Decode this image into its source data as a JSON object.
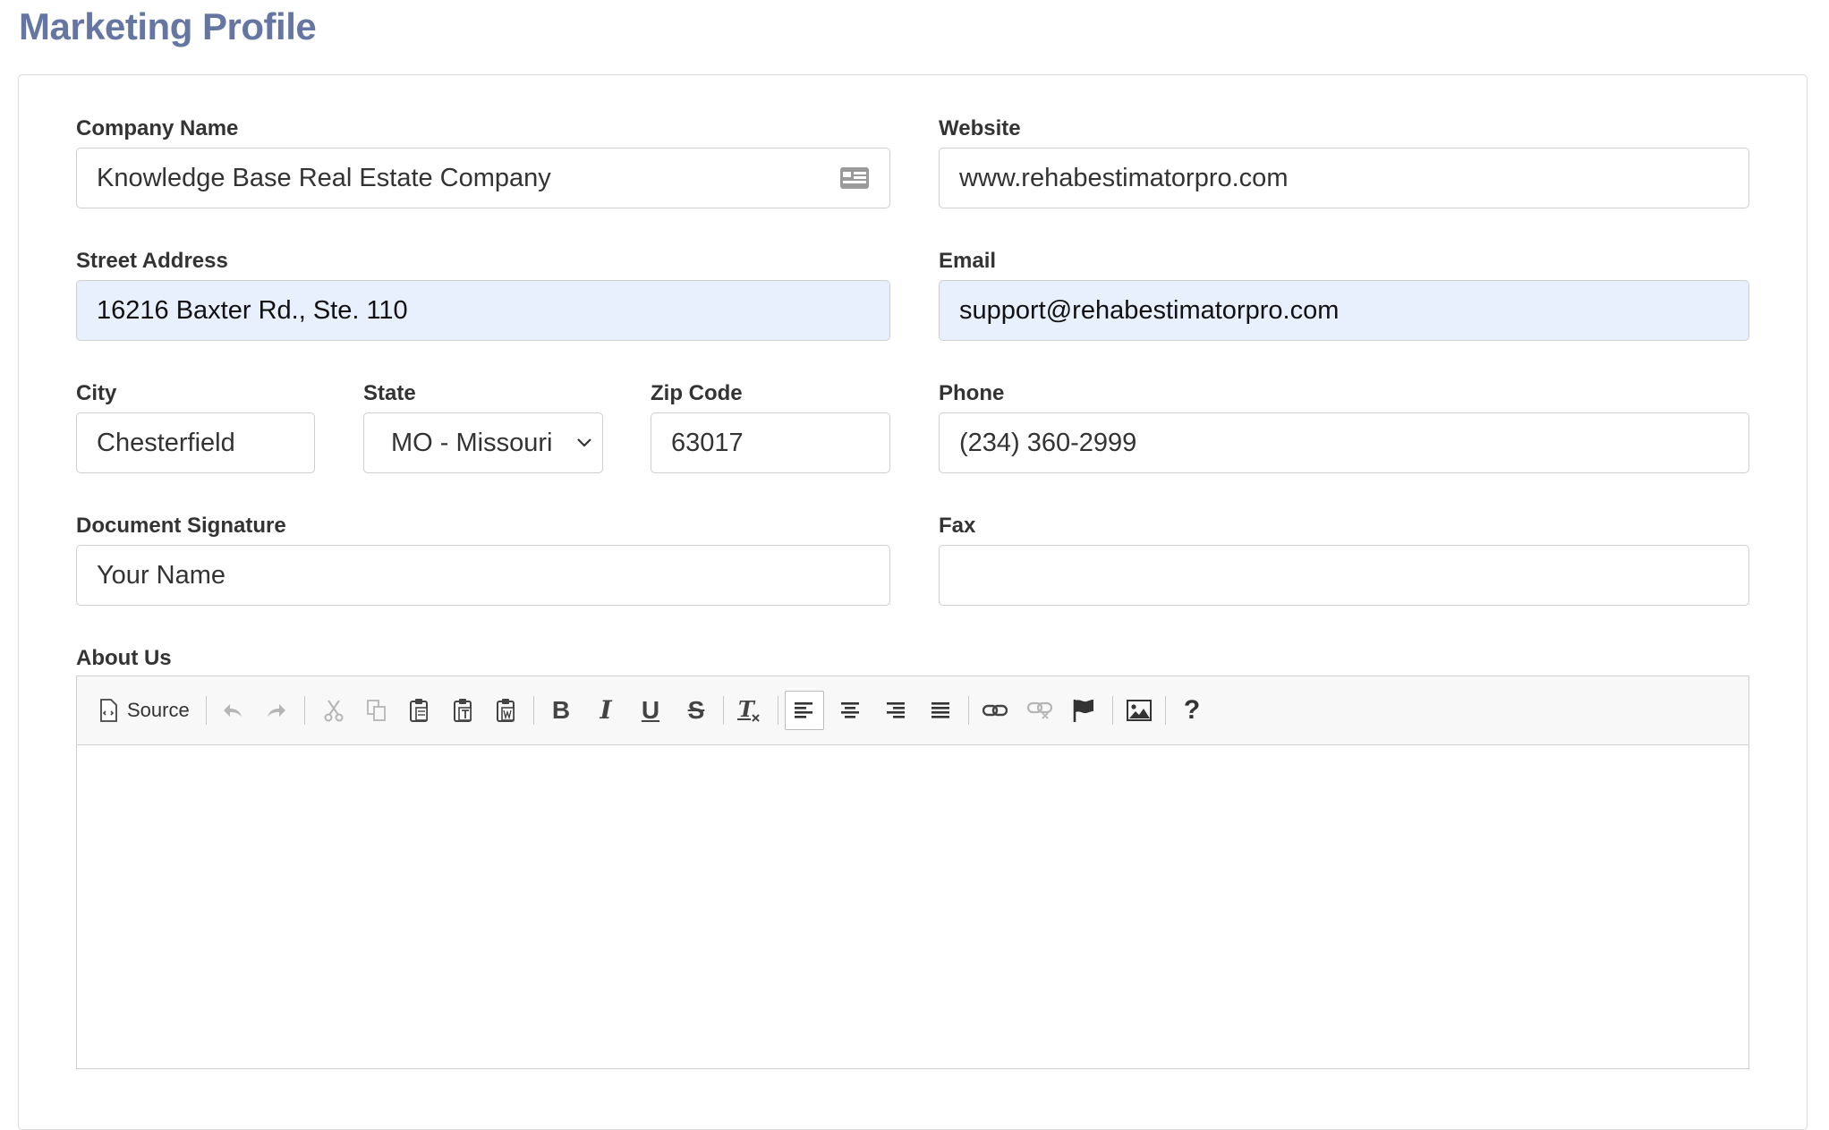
{
  "page": {
    "title": "Marketing Profile"
  },
  "form": {
    "company_name": {
      "label": "Company Name",
      "value": "Knowledge Base Real Estate Company"
    },
    "website": {
      "label": "Website",
      "value": "www.rehabestimatorpro.com"
    },
    "street_address": {
      "label": "Street Address",
      "value": "16216 Baxter Rd., Ste. 110"
    },
    "email": {
      "label": "Email",
      "value": "support@rehabestimatorpro.com"
    },
    "city": {
      "label": "City",
      "value": "Chesterfield"
    },
    "state": {
      "label": "State",
      "value": "MO - Missouri"
    },
    "zip": {
      "label": "Zip Code",
      "value": "63017"
    },
    "phone": {
      "label": "Phone",
      "value": "(234) 360-2999"
    },
    "signature": {
      "label": "Document Signature",
      "value": "Your Name"
    },
    "fax": {
      "label": "Fax",
      "value": ""
    },
    "about": {
      "label": "About Us",
      "value": ""
    }
  },
  "editor_toolbar": {
    "source_label": "Source",
    "buttons": [
      "source-icon",
      "undo-icon",
      "redo-icon",
      "cut-icon",
      "copy-icon",
      "paste-icon",
      "paste-text-icon",
      "paste-word-icon",
      "bold-icon",
      "italic-icon",
      "underline-icon",
      "strikethrough-icon",
      "remove-format-icon",
      "align-left-icon",
      "align-center-icon",
      "align-right-icon",
      "align-justify-icon",
      "link-icon",
      "unlink-icon",
      "anchor-flag-icon",
      "image-icon",
      "help-icon"
    ],
    "active": "align-left-icon"
  },
  "colors": {
    "title": "#6576a2",
    "autofill_bg": "#e8f0fe",
    "border": "#cfcfcf"
  }
}
